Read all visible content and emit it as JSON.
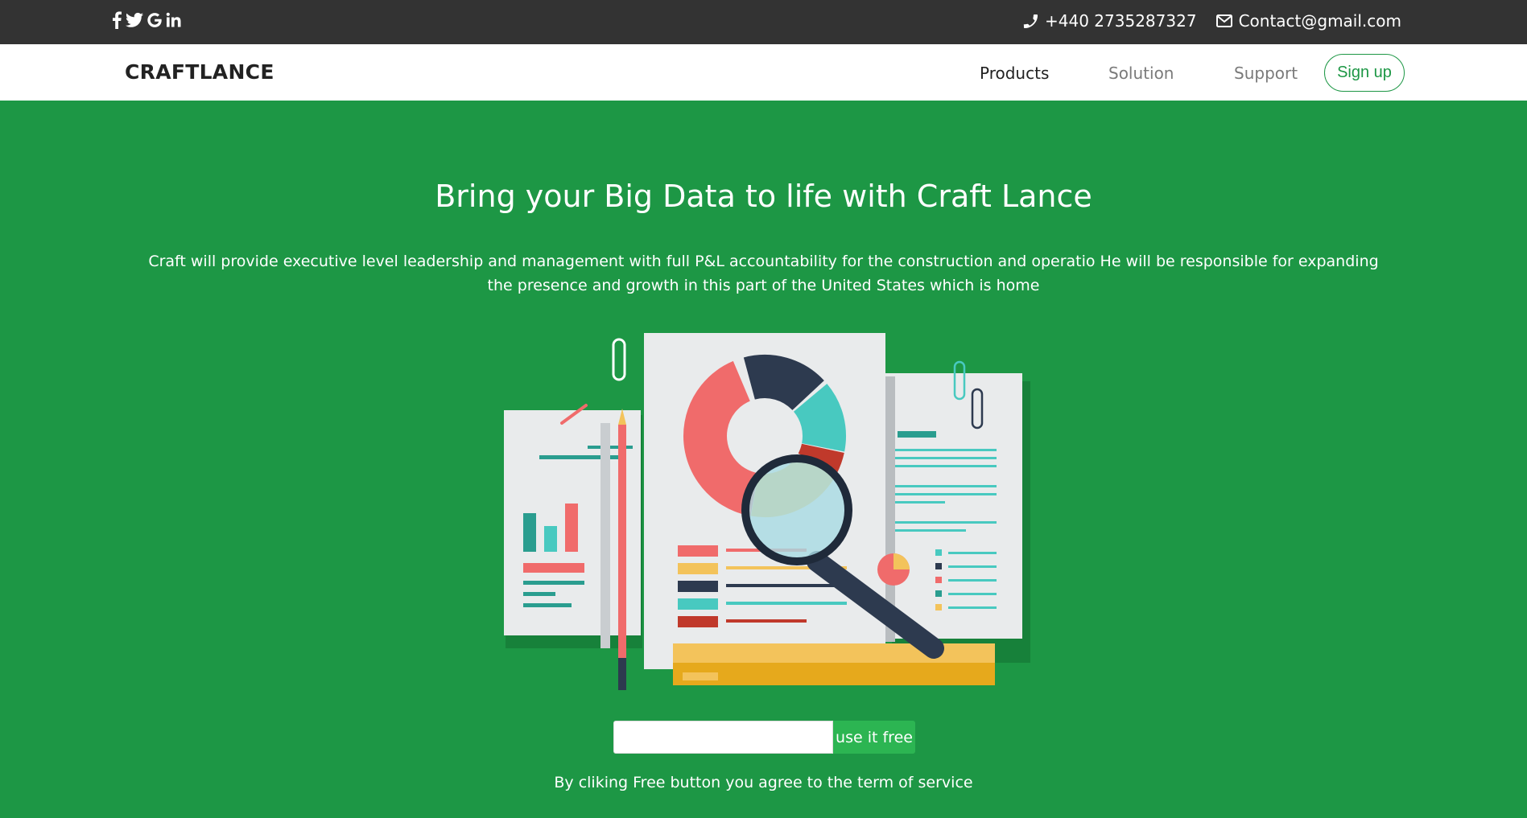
{
  "topbar": {
    "social_icons": [
      "facebook-icon",
      "twitter-icon",
      "google-icon",
      "linkedin-icon"
    ],
    "phone": "+440 2735287327",
    "email": "Contact@gmail.com"
  },
  "navbar": {
    "brand": "CRAFTLANCE",
    "links": [
      {
        "label": "Products",
        "active": true
      },
      {
        "label": "Solution",
        "active": false
      },
      {
        "label": "Support",
        "active": false
      }
    ],
    "signup": "Sign up"
  },
  "hero": {
    "title": "Bring your Big Data to life with Craft Lance",
    "description": "Craft will provide executive level leadership and management with full P&L accountability for the construction and operatio He will be responsible for expanding the presence and growth in this part of the United States which is home",
    "input_value": "",
    "button": "use it free",
    "terms": "By cliking Free button you agree to the term of service"
  },
  "colors": {
    "background": "#1d9745",
    "topbar": "#333333",
    "accent": "#1d9745",
    "button": "#2cb552"
  }
}
